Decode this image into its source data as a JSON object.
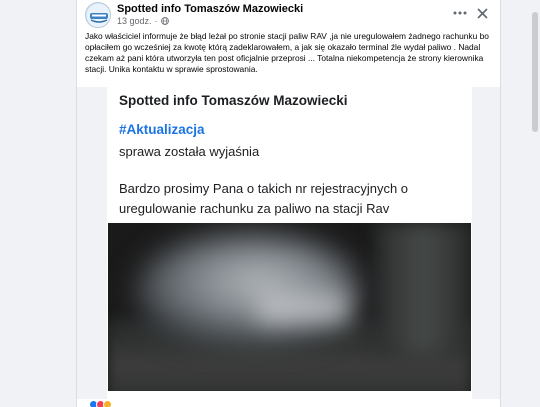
{
  "post": {
    "author": "Spotted info Tomaszów Mazowiecki",
    "time": "13 godz.",
    "separator": "·",
    "text": "Jako właściciel informuje że błąd leżał po stronie stacji paliw RAV ,ja nie uregulowałem żadnego rachunku bo opłaciłem go wcześniej za kwotę którą zadeklarowałem,  a jak się okazało terminal źle wydał paliwo . Nadal czekam aż pani która utworzyła ten post oficjalnie przeprosi ... Totalna niekompetencja że strony kierownika stacji. Unika kontaktu w sprawie sprostowania."
  },
  "shared_image": {
    "title": "Spotted info Tomaszów Mazowiecki",
    "hashtag": "#Aktualizacja",
    "line1": "sprawa została wyjaśnia",
    "line2": "Bardzo prosimy Pana o takich nr rejestracyjnych o uregulowanie rachunku za paliwo na stacji Rav"
  },
  "icons": {
    "avatar": "page-avatar",
    "globe": "globe-icon",
    "more": "more-options-icon",
    "close": "close-icon"
  },
  "colors": {
    "link": "#1b74e4",
    "meta_text": "#65676b",
    "background": "#f0f2f5"
  }
}
